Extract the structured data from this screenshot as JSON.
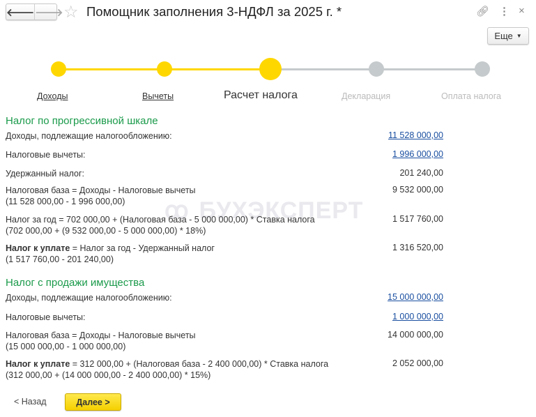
{
  "window": {
    "title": "Помощник заполнения 3-НДФЛ за 2025 г. *",
    "more_label": "Еще"
  },
  "watermark": "БУХЭКСПЕРТ",
  "steps": [
    {
      "label": "Доходы"
    },
    {
      "label": "Вычеты"
    },
    {
      "label": "Расчет налога"
    },
    {
      "label": "Декларация"
    },
    {
      "label": "Оплата налога"
    }
  ],
  "colors": {
    "accent": "#FFD700",
    "inactive": "#C5CACC",
    "heading": "#1A9A4A",
    "link": "#1A4FA0"
  },
  "progressive": {
    "heading": "Налог по прогрессивной шкале",
    "income_label": "Доходы, подлежащие налогообложению:",
    "income_value": "11 528 000,00",
    "deductions_label": "Налоговые вычеты:",
    "deductions_value": "1 996 000,00",
    "withheld_label": "Удержанный налог:",
    "withheld_value": "201 240,00",
    "base_label": "Налоговая база = Доходы - Налоговые вычеты",
    "base_calc": "(11 528 000,00 - 1 996 000,00)",
    "base_value": "9 532 000,00",
    "year_label": "Налог за год = 702 000,00 + (Налоговая база - 5 000 000,00) * Ставка налога",
    "year_calc": "(702 000,00 + (9 532 000,00 - 5 000 000,00) * 18%)",
    "year_value": "1 517 760,00",
    "pay_bold": "Налог к уплате",
    "pay_label": " = Налог за год - Удержанный налог",
    "pay_calc": "(1 517 760,00 - 201 240,00)",
    "pay_value": "1 316 520,00"
  },
  "property": {
    "heading": "Налог с продажи имущества",
    "income_label": "Доходы, подлежащие налогообложению:",
    "income_value": "15 000 000,00",
    "deductions_label": "Налоговые вычеты:",
    "deductions_value": "1 000 000,00",
    "base_label": "Налоговая база = Доходы - Налоговые вычеты",
    "base_calc": "(15 000 000,00 - 1 000 000,00)",
    "base_value": "14 000 000,00",
    "pay_bold": "Налог к уплате",
    "pay_label": " = 312 000,00 + (Налоговая база - 2 400 000,00) * Ставка налога",
    "pay_calc": "(312 000,00 + (14 000 000,00 - 2 400 000,00) * 15%)",
    "pay_value": "2 052 000,00"
  },
  "footer": {
    "back_label": "< Назад",
    "next_label": "Далее >"
  }
}
